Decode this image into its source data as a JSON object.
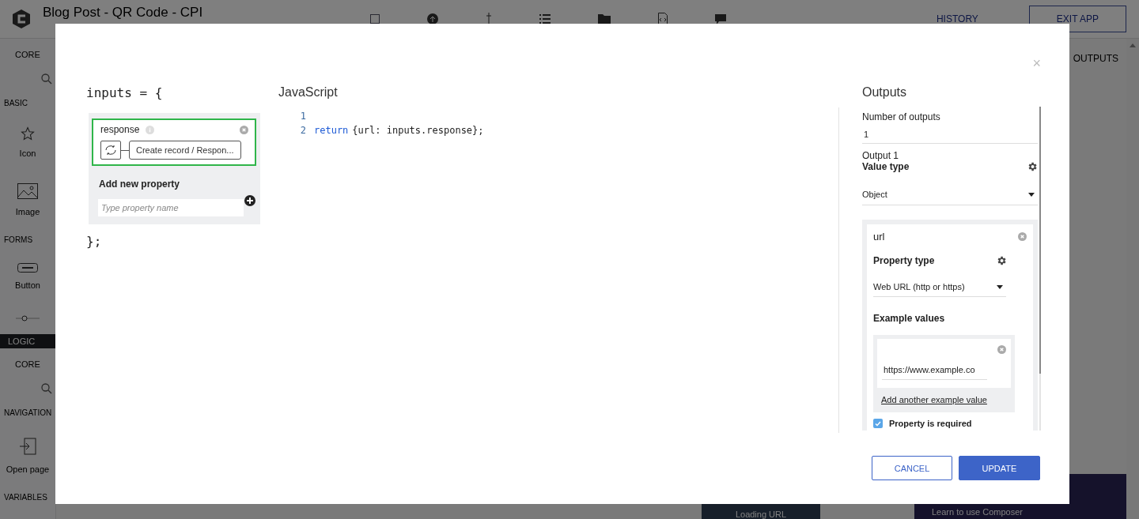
{
  "app": {
    "title": "Blog Post - QR Code - CPI",
    "header_buttons": [
      {
        "label": "HISTORY",
        "kind": "text"
      },
      {
        "label": "EXIT APP",
        "kind": "outline"
      }
    ],
    "side_tab": "OUTPUTS",
    "sidebar": [
      {
        "kind": "subheading",
        "label": "CORE"
      },
      {
        "kind": "search"
      },
      {
        "kind": "section",
        "label": "BASIC"
      },
      {
        "kind": "tile",
        "label": "Icon"
      },
      {
        "kind": "tile",
        "label": "Image"
      },
      {
        "kind": "section",
        "label": "FORMS"
      },
      {
        "kind": "tile",
        "label": "Button"
      },
      {
        "kind": "tile"
      },
      {
        "kind": "bar",
        "label": "LOGIC"
      },
      {
        "kind": "subheading",
        "label": "CORE"
      },
      {
        "kind": "search"
      },
      {
        "kind": "section",
        "label": "NAVIGATION"
      },
      {
        "kind": "tile",
        "label": "Open page"
      },
      {
        "kind": "section",
        "label": "VARIABLES"
      }
    ],
    "loading": "Loading URL",
    "banner": "Learn to use Composer"
  },
  "dialog": {
    "close": "×",
    "inputs_open": "inputs = {",
    "inputs_close": "};",
    "inputs": [
      {
        "name": "response",
        "source": "Create record / Respon..."
      }
    ],
    "add_property": {
      "label": "Add new property",
      "placeholder": "Type property name"
    },
    "editor": {
      "title": "JavaScript",
      "lines": [
        {
          "number": "1"
        },
        {
          "number": "2",
          "tokens": [
            {
              "kind": "keyword",
              "text": "return"
            },
            {
              "kind": "plain",
              "text": "{url: inputs.response};"
            }
          ]
        }
      ]
    },
    "outputs": {
      "title": "Outputs",
      "count_label": "Number of outputs",
      "count": "1",
      "output_title": "Output 1",
      "value_type_label": "Value type",
      "value_type": "Object",
      "properties": [
        {
          "name": "url",
          "type_label": "Property type",
          "type": "Web URL (http or https)",
          "examples_label": "Example values",
          "examples": [
            "https://www.example.co"
          ],
          "add_example": "Add another example value",
          "required_label": "Property is required",
          "required": true
        }
      ]
    },
    "buttons": [
      {
        "label": "CANCEL",
        "kind": "secondary"
      },
      {
        "label": "UPDATE",
        "kind": "primary"
      }
    ]
  }
}
